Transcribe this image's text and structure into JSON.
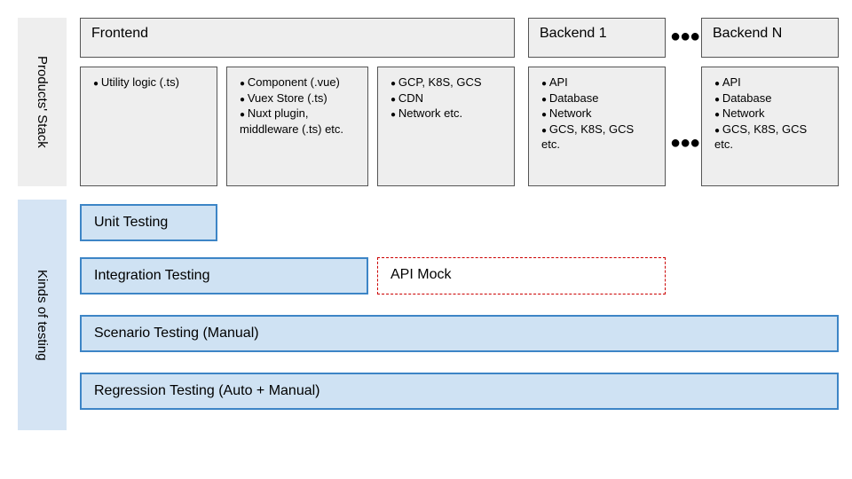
{
  "labels": {
    "products_stack": "Products' Stack",
    "kinds_of_testing": "Kinds of testing"
  },
  "stack": {
    "frontend": {
      "title": "Frontend",
      "col1": [
        "Utility logic (.ts)"
      ],
      "col2": [
        "Component (.vue)",
        "Vuex Store (.ts)",
        "Nuxt plugin, middleware (.ts) etc."
      ],
      "col3": [
        "GCP, K8S, GCS",
        "CDN",
        "Network etc."
      ]
    },
    "backend1": {
      "title": "Backend 1",
      "items": [
        "API",
        "Database",
        "Network",
        "GCS, K8S, GCS etc."
      ]
    },
    "backendN": {
      "title": "Backend N",
      "items": [
        "API",
        "Database",
        "Network",
        "GCS, K8S, GCS etc."
      ]
    },
    "ellipsis": "●●●"
  },
  "testing": {
    "unit": "Unit Testing",
    "integration": "Integration Testing",
    "api_mock": "API Mock",
    "scenario": "Scenario Testing (Manual)",
    "regression": "Regression Testing (Auto + Manual)"
  }
}
